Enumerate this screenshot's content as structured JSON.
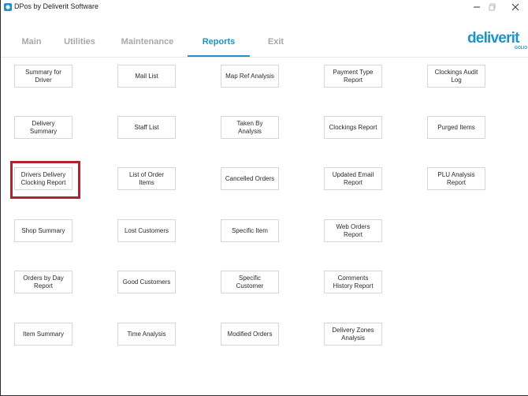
{
  "window": {
    "title": "DPos by Deliverit Software",
    "icons": {
      "app": "app-icon",
      "minimize": "minimize-icon",
      "maximize": "maximize-icon",
      "close": "close-icon"
    }
  },
  "menu": {
    "tabs": [
      {
        "label": "Main",
        "active": false
      },
      {
        "label": "Utilities",
        "active": false
      },
      {
        "label": "Maintenance",
        "active": false
      },
      {
        "label": "Reports",
        "active": true
      },
      {
        "label": "Exit",
        "active": false
      }
    ]
  },
  "logo": {
    "text": "deliverit",
    "sub": "GOLIO"
  },
  "colors": {
    "accent": "#1f93c8",
    "highlight": "#b0222e",
    "inactive_tab": "#a8a8a8"
  },
  "reports": {
    "rows": [
      [
        "Summary for Driver",
        "Mail List",
        "Map Ref Analysis",
        "Payment Type Report",
        "Clockings Audit Log"
      ],
      [
        "Delivery Summary",
        "Staff List",
        "Taken By Analysis",
        "Clockings Report",
        "Purged Items"
      ],
      [
        "Drivers Delivery Clocking Report",
        "List of Order Items",
        "Cancelled Orders",
        "Updated Email Report",
        "PLU Analysis Report"
      ],
      [
        "Shop Summary",
        "Lost Customers",
        "Specific Item",
        "Web Orders Report",
        ""
      ],
      [
        "Orders by Day Report",
        "Good Customers",
        "Specific Customer",
        "Comments History Report",
        ""
      ],
      [
        "Item Summary",
        "Time Analysis",
        "Modified Orders",
        "Delivery Zones Analysis",
        ""
      ]
    ],
    "highlighted": "Drivers Delivery Clocking Report"
  }
}
